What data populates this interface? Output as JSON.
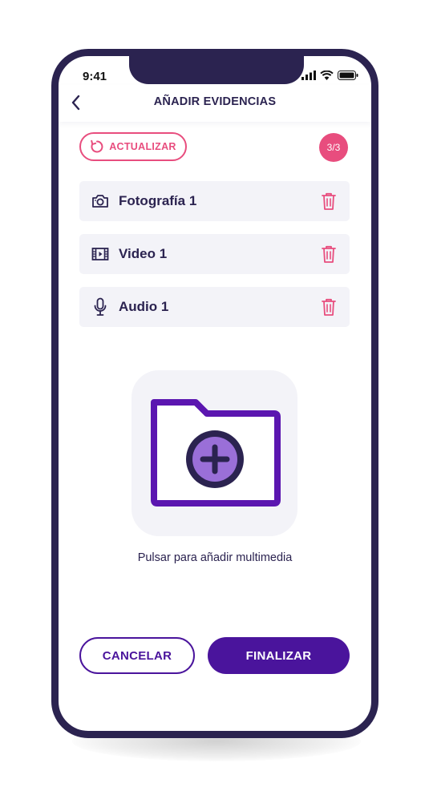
{
  "status_bar": {
    "time": "9:41",
    "icons": [
      "signal-icon",
      "wifi-icon",
      "battery-icon"
    ]
  },
  "header": {
    "title": "AÑADIR EVIDENCIAS",
    "back_icon": "chevron-left-icon"
  },
  "toolbar": {
    "refresh_label": "ACTUALIZAR",
    "refresh_icon": "refresh-icon",
    "counter": "3/3"
  },
  "evidences": [
    {
      "label": "Fotografía 1",
      "icon": "camera-icon"
    },
    {
      "label": "Video 1",
      "icon": "film-icon"
    },
    {
      "label": "Audio 1",
      "icon": "microphone-icon"
    }
  ],
  "add_media": {
    "caption": "Pulsar para añadir multimedia",
    "icon": "folder-add-icon"
  },
  "actions": {
    "cancel_label": "CANCELAR",
    "finish_label": "FINALIZAR"
  },
  "colors": {
    "dark": "#2b2350",
    "accent_pink": "#e84d7e",
    "primary_purple": "#4a149c",
    "light_purple": "#9a6fd8",
    "tile_bg": "#f3f3f8"
  }
}
